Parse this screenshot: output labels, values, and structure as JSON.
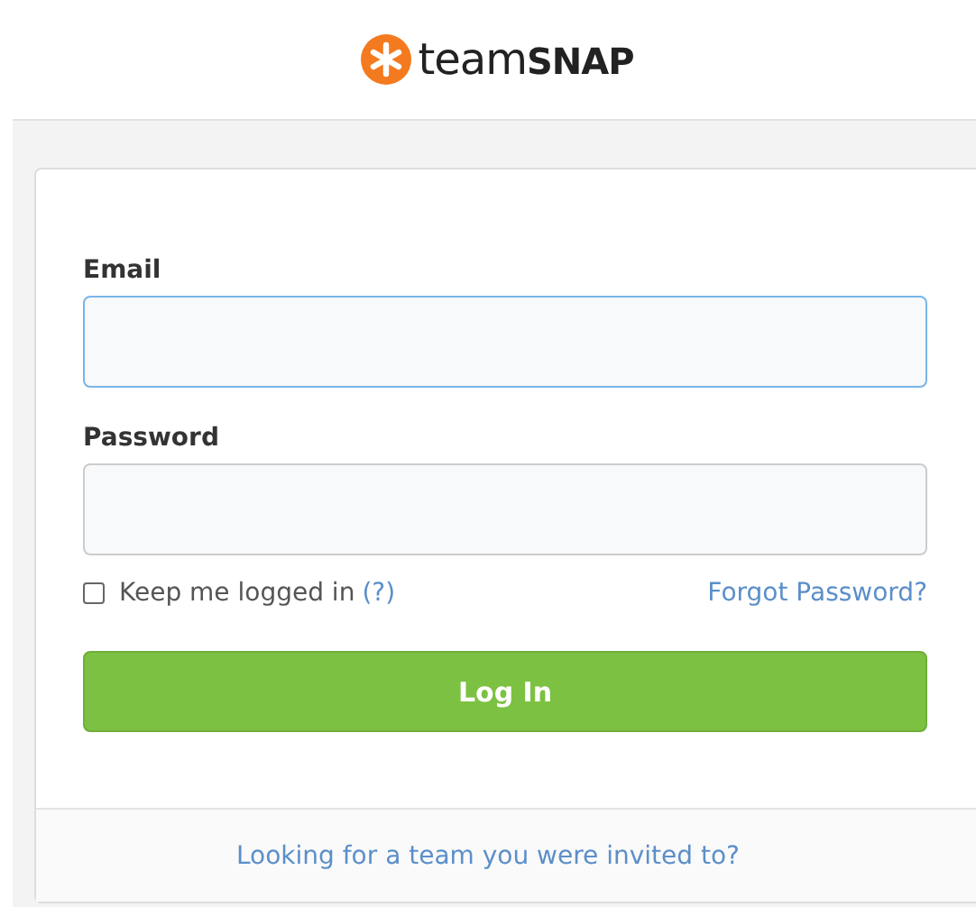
{
  "logo": {
    "wordmark": "team**SNAP**"
  },
  "form": {
    "fields": [
      {
        "label": "Email",
        "focused": true
      },
      {
        "label": "Password",
        "focused": false
      }
    ],
    "remember": {
      "label": "Keep me logged in",
      "help": "(?)",
      "checked": false
    },
    "forgot_link": "Forgot Password?",
    "submit": "Log In"
  },
  "footer_link": "Looking for a team you were invited to?"
}
